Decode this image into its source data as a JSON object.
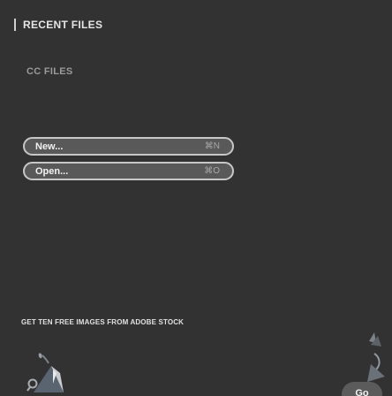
{
  "section": {
    "title": "RECENT FILES",
    "subtitle": "CC FILES"
  },
  "commands": [
    {
      "label": "New...",
      "shortcut": "⌘N"
    },
    {
      "label": "Open...",
      "shortcut": "⌘O"
    }
  ],
  "stock": {
    "banner": "GET TEN FREE IMAGES FROM ADOBE STOCK",
    "go_label": "Go"
  }
}
